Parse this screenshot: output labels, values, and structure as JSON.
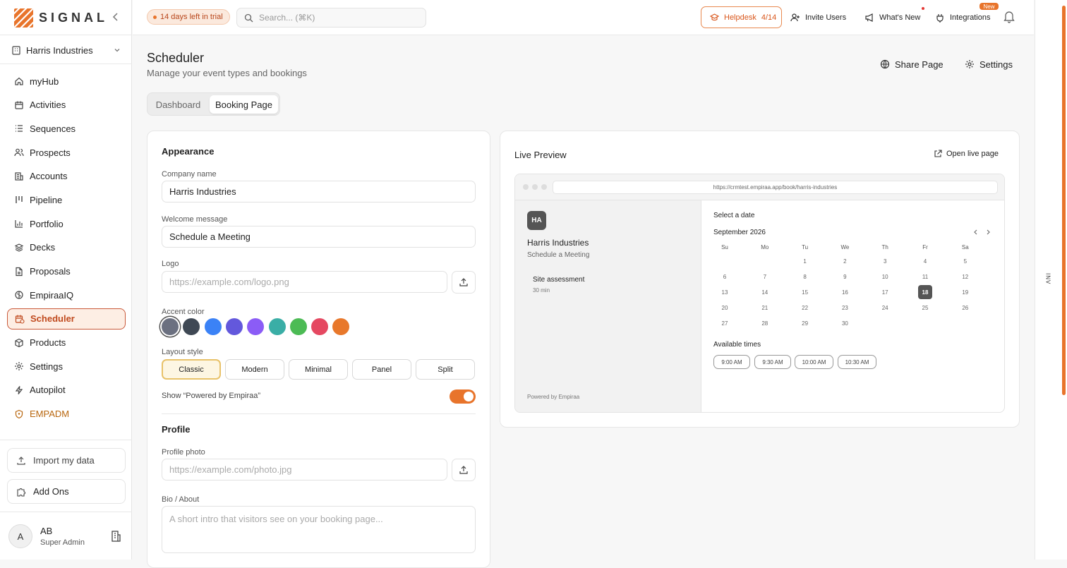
{
  "brand": {
    "name": "SIGNAL",
    "accent": "#e8742b"
  },
  "sidebar": {
    "org": "Harris Industries",
    "items": [
      {
        "label": "myHub",
        "icon": "home-icon"
      },
      {
        "label": "Activities",
        "icon": "calendar-icon"
      },
      {
        "label": "Sequences",
        "icon": "list-icon"
      },
      {
        "label": "Prospects",
        "icon": "users-icon"
      },
      {
        "label": "Accounts",
        "icon": "building-icon"
      },
      {
        "label": "Pipeline",
        "icon": "kanban-icon"
      },
      {
        "label": "Portfolio",
        "icon": "bar-chart-icon"
      },
      {
        "label": "Decks",
        "icon": "layers-icon"
      },
      {
        "label": "Proposals",
        "icon": "file-icon"
      },
      {
        "label": "EmpiraaIQ",
        "icon": "brain-icon"
      },
      {
        "label": "Scheduler",
        "icon": "calendar-clock-icon",
        "active": true
      },
      {
        "label": "Products",
        "icon": "box-icon"
      },
      {
        "label": "Settings",
        "icon": "gear-icon"
      },
      {
        "label": "Autopilot",
        "icon": "zap-icon"
      },
      {
        "label": "EMPADM",
        "icon": "shield-icon"
      }
    ],
    "import_label": "Import my data",
    "addons_label": "Add Ons",
    "user": {
      "initial": "A",
      "name": "AB",
      "role": "Super Admin"
    }
  },
  "topbar": {
    "trial": "14 days left in trial",
    "search_placeholder": "Search... (⌘K)",
    "helpdesk_label": "Helpdesk",
    "helpdesk_count": "4/14",
    "invite": "Invite Users",
    "whats_new": "What's New",
    "integrations": "Integrations",
    "new_badge": "New"
  },
  "page": {
    "title": "Scheduler",
    "subtitle": "Manage your event types and bookings",
    "share": "Share Page",
    "settings": "Settings",
    "tabs": [
      "Dashboard",
      "Booking Page"
    ]
  },
  "appearance": {
    "title": "Appearance",
    "company_label": "Company name",
    "company_value": "Harris Industries",
    "welcome_label": "Welcome message",
    "welcome_value": "Schedule a Meeting",
    "logo_label": "Logo",
    "logo_placeholder": "https://example.com/logo.png",
    "accent_label": "Accent color",
    "accent_colors": [
      "#6b7080",
      "#3f4854",
      "#3b82f6",
      "#6358dc",
      "#8b5cf6",
      "#3aaea6",
      "#4cbb55",
      "#e54861",
      "#e8782b"
    ],
    "layout_label": "Layout style",
    "layouts": [
      "Classic",
      "Modern",
      "Minimal",
      "Panel",
      "Split"
    ],
    "powered_label": "Show “Powered by Empiraa”",
    "powered_on": true
  },
  "profile": {
    "title": "Profile",
    "photo_label": "Profile photo",
    "photo_placeholder": "https://example.com/photo.jpg",
    "bio_label": "Bio / About",
    "bio_placeholder": "A short intro that visitors see on your booking page..."
  },
  "preview": {
    "title": "Live Preview",
    "open": "Open live page",
    "url": "https://crmtest.empiraa.app/book/harris-industries",
    "initials": "HA",
    "company": "Harris Industries",
    "welcome": "Schedule a Meeting",
    "event_name": "Site assessment",
    "event_duration": "30 min",
    "powered": "Powered by Empiraa",
    "select_date": "Select a date",
    "month": "September 2026",
    "weekdays": [
      "Su",
      "Mo",
      "Tu",
      "We",
      "Th",
      "Fr",
      "Sa"
    ],
    "first_weekday": 2,
    "days_in_month": 30,
    "selected_day": 18,
    "available_label": "Available times",
    "times": [
      "9:00 AM",
      "9:30 AM",
      "10:00 AM",
      "10:30 AM"
    ]
  },
  "side_tab": "INV"
}
